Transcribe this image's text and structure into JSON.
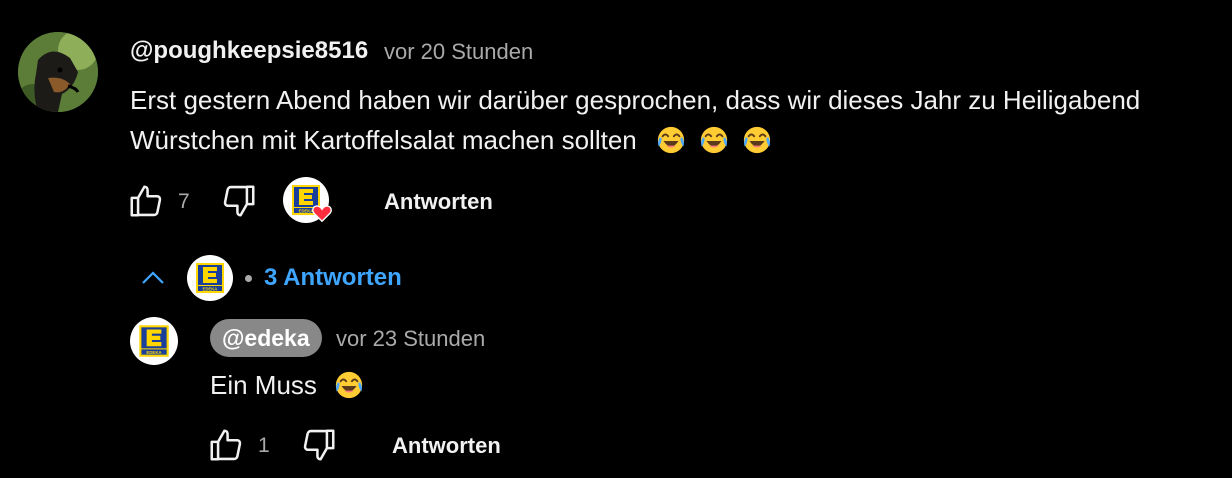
{
  "comment": {
    "author": "@poughkeepsie8516",
    "time": "vor 20 Stunden",
    "text_line1": "Erst gestern Abend haben wir darüber gesprochen, dass wir dieses Jahr zu Heiligabend",
    "text_line2": "Würstchen mit Kartoffelsalat machen sollten",
    "emoji": "face-with-tears-of-joy-icon",
    "like_count": "7",
    "reply_label": "Antworten",
    "hearted_by_creator": true
  },
  "replies_toggle": {
    "label": "3 Antworten",
    "expanded": true
  },
  "reply": {
    "author": "@edeka",
    "time": "vor 23 Stunden",
    "text": "Ein Muss",
    "like_count": "1",
    "reply_label": "Antworten"
  },
  "colors": {
    "background": "#000000",
    "text": "#f1f1f1",
    "secondary": "#aaaaaa",
    "link": "#3ea6ff",
    "edeka_blue": "#1a3f9a",
    "edeka_yellow": "#ffd600",
    "heart": "#ff2d3d"
  }
}
